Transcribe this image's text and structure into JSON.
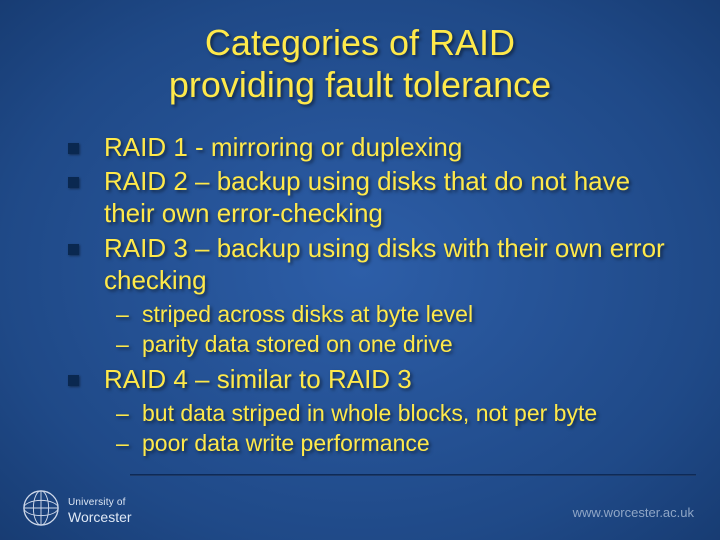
{
  "title_line1": "Categories of RAID",
  "title_line2": "providing fault tolerance",
  "bullets": [
    {
      "text": "RAID 1 - mirroring or duplexing"
    },
    {
      "text": "RAID 2 – backup using disks that do not have their own error-checking"
    },
    {
      "text": "RAID 3 – backup using disks with their own error checking"
    }
  ],
  "sub1": [
    {
      "text": "striped across disks at byte level"
    },
    {
      "text": "parity data stored on one drive"
    }
  ],
  "bullets2": [
    {
      "text": "RAID 4 – similar to RAID 3"
    }
  ],
  "sub2": [
    {
      "text": "but data striped in whole blocks, not per byte"
    },
    {
      "text": "poor data write performance"
    }
  ],
  "footer": {
    "university_top": "University of",
    "university_bottom": "Worcester",
    "url": "www.worcester.ac.uk"
  },
  "colors": {
    "text": "#ffe94a",
    "bg_center": "#2d5ea8",
    "bg_edge": "#051a3d",
    "bullet": "#0a2850"
  }
}
